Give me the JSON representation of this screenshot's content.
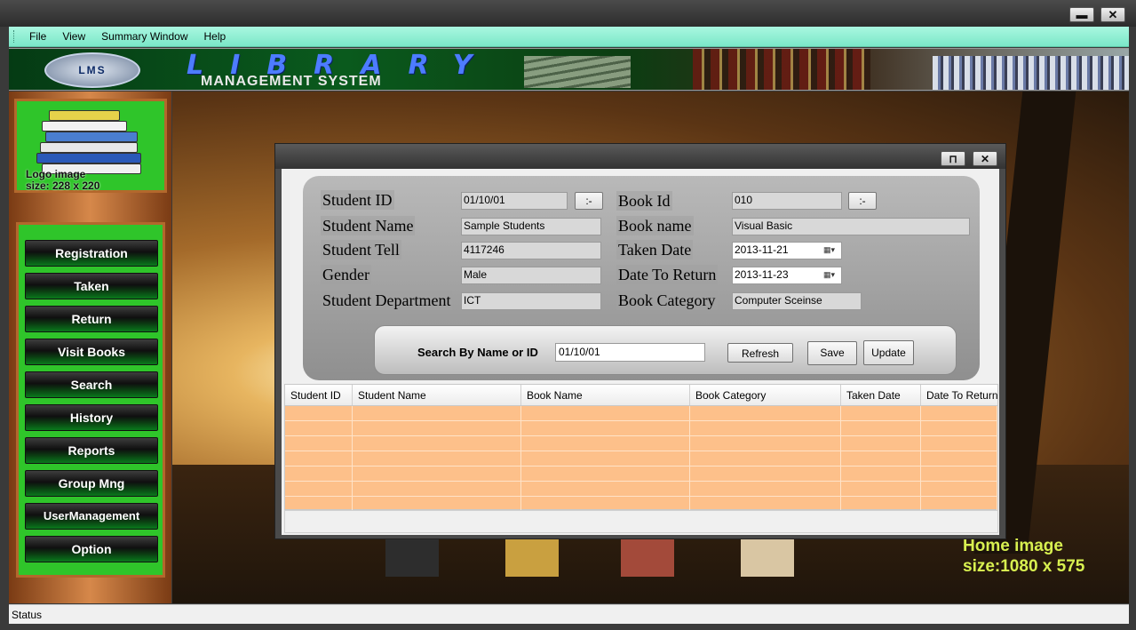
{
  "menu": {
    "items": [
      "File",
      "View",
      "Summary Window",
      "Help"
    ]
  },
  "banner": {
    "logo_text": "LMS",
    "title": "LIBRARY",
    "subtitle": "MANAGEMENT SYSTEM"
  },
  "left_panel": {
    "logo_caption_line1": "Logo image",
    "logo_caption_line2": "size: 228 x 220",
    "nav": [
      "Registration",
      "Taken",
      "Return",
      "Visit Books",
      "Search",
      "History",
      "Reports",
      "Group Mng",
      "UserManagement",
      "Option"
    ]
  },
  "home_caption": {
    "line1": "Home image",
    "line2": "size:1080 x  575"
  },
  "status": "Status",
  "dialog": {
    "form": {
      "student_id_label": "Student ID",
      "student_id_value": "01/10/01",
      "student_id_btn": ":-",
      "student_name_label": "Student Name",
      "student_name_value": "Sample Students",
      "student_tell_label": "Student Tell",
      "student_tell_value": "4117246",
      "gender_label": "Gender",
      "gender_value": "Male",
      "department_label": "Student Department",
      "department_value": "ICT",
      "book_id_label": "Book Id",
      "book_id_value": "010",
      "book_id_btn": ":-",
      "book_name_label": "Book name",
      "book_name_value": "Visual Basic",
      "taken_date_label": "Taken Date",
      "taken_date_value": "2013-11-21",
      "return_date_label": "Date To Return",
      "return_date_value": "2013-11-23",
      "category_label": "Book Category",
      "category_value": "Computer Sceinse"
    },
    "search": {
      "label": "Search By Name or ID",
      "value": "01/10/01",
      "refresh": "Refresh",
      "save": "Save",
      "update": "Update"
    },
    "grid": {
      "columns": [
        "Student ID",
        "Student Name",
        "Book Name",
        "Book Category",
        "Taken Date",
        "Date To Return"
      ]
    }
  },
  "colors": {
    "menu_bg": "#7be7c8",
    "nav_bg": "#2fc52a",
    "grid_row": "#fdc08a",
    "home_caption": "#d8f050"
  }
}
